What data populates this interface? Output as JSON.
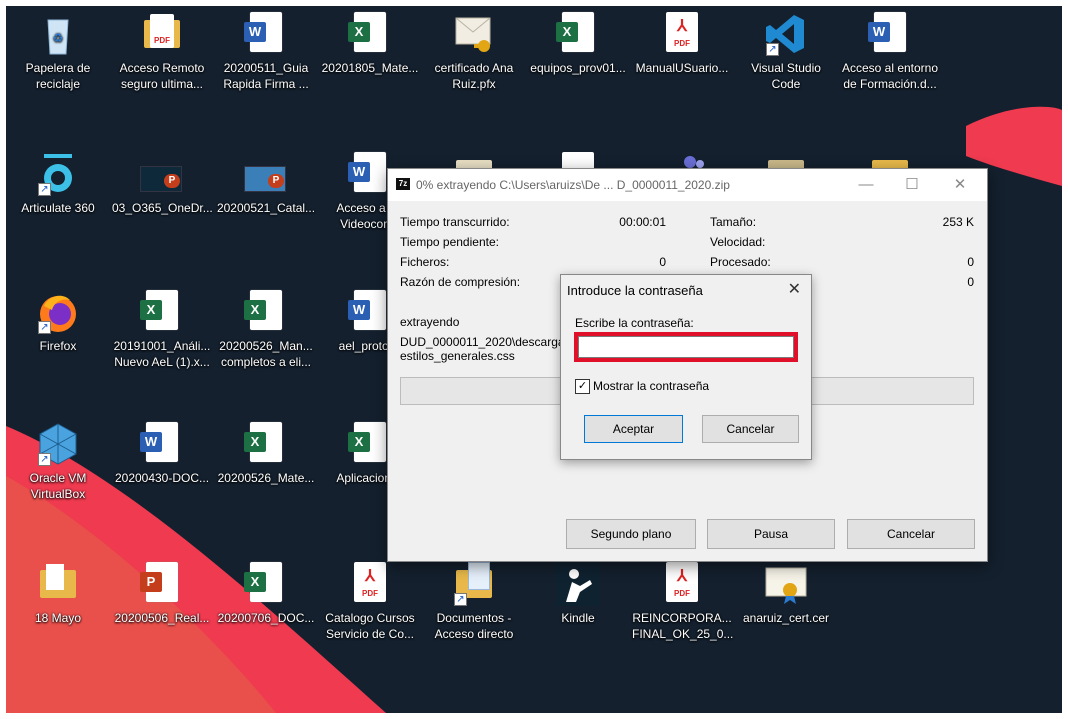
{
  "desktop": {
    "icons": [
      {
        "label": "Papelera de reciclaje",
        "type": "recycle"
      },
      {
        "label": "Acceso Remoto seguro ultima...",
        "type": "pdf-folder"
      },
      {
        "label": "20200511_Guia Rapida Firma ...",
        "type": "word"
      },
      {
        "label": "20201805_Mate...",
        "type": "excel"
      },
      {
        "label": "certificado Ana Ruiz.pfx",
        "type": "cert"
      },
      {
        "label": "equipos_prov01...",
        "type": "excel"
      },
      {
        "label": "ManualUSuario...",
        "type": "pdf"
      },
      {
        "label": "Visual Studio Code",
        "type": "vscode"
      },
      {
        "label": "Acceso al entorno de Formación.d...",
        "type": "word"
      },
      {
        "label": "Articulate 360",
        "type": "articulate"
      },
      {
        "label": "03_O365_OneDr...",
        "type": "ppt"
      },
      {
        "label": "20200521_Catal...",
        "type": "ppt"
      },
      {
        "label": "Acceso a Sa Videoconfe",
        "type": "word"
      },
      {
        "label": "Firefox",
        "type": "firefox"
      },
      {
        "label": "20191001_Análi... Nuevo AeL (1).x...",
        "type": "excel"
      },
      {
        "label": "20200526_Man... completos a eli...",
        "type": "excel"
      },
      {
        "label": "ael_protoco",
        "type": "word"
      },
      {
        "label": "Oracle VM VirtualBox",
        "type": "vbox"
      },
      {
        "label": "20200430-DOC...",
        "type": "word"
      },
      {
        "label": "20200526_Mate...",
        "type": "excel"
      },
      {
        "label": "Aplicaciones",
        "type": "excel"
      },
      {
        "label": "18 Mayo",
        "type": "folder"
      },
      {
        "label": "20200506_Real...",
        "type": "ppt"
      },
      {
        "label": "20200706_DOC...",
        "type": "excel"
      },
      {
        "label": "Catalogo Cursos Servicio de Co...",
        "type": "pdf"
      },
      {
        "label": "Documentos - Acceso directo",
        "type": "folder"
      },
      {
        "label": "Kindle",
        "type": "kindle"
      },
      {
        "label": "REINCORPORA... FINAL_OK_25_0...",
        "type": "pdf"
      },
      {
        "label": "anaruiz_cert.cer",
        "type": "cert"
      }
    ],
    "pdf_text": "PDF",
    "tag_w": "W",
    "tag_x": "X",
    "tag_p": "P"
  },
  "extract_window": {
    "app_icon_text": "7z",
    "title": "0% extrayendo C:\\Users\\aruizs\\De ... D_0000011_2020.zip",
    "minimize": "—",
    "maximize": "☐",
    "close": "✕",
    "labels": {
      "elapsed": "Tiempo transcurrido:",
      "remaining": "Tiempo pendiente:",
      "files": "Ficheros:",
      "ratio": "Razón de compresión:",
      "size": "Tamaño:",
      "speed": "Velocidad:",
      "processed": "Procesado:"
    },
    "values": {
      "elapsed": "00:00:01",
      "files": "0",
      "size": "253 K",
      "processed": "0",
      "compressed": "0"
    },
    "status": "extrayendo",
    "path_line1": "DUD_0000011_2020\\descarga\\",
    "path_line2": "estilos_generales.css",
    "progress_percent": 0,
    "buttons": {
      "background": "Segundo plano",
      "pause": "Pausa",
      "cancel": "Cancelar"
    }
  },
  "password_dialog": {
    "title": "Introduce la contraseña",
    "close": "✕",
    "prompt": "Escribe la contraseña:",
    "value": "",
    "show_password_label": "Mostrar la contraseña",
    "show_password_checked": true,
    "check_mark": "✓",
    "ok": "Aceptar",
    "cancel": "Cancelar"
  },
  "colors": {
    "desktop_bg": "#14202e",
    "highlight_box": "#e0102a",
    "wallpaper_accent": "#ef3a4f"
  }
}
